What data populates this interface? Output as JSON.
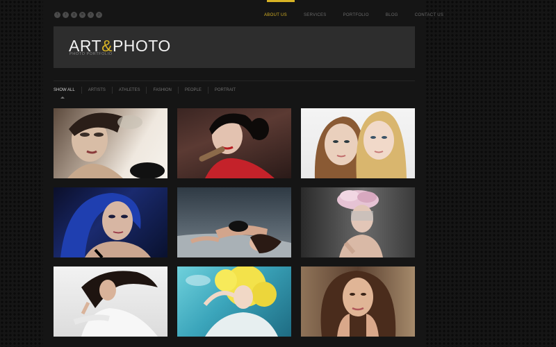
{
  "social": {
    "icons": [
      "facebook-icon",
      "twitter-icon",
      "google-plus-icon",
      "linkedin-icon",
      "rss-icon",
      "pinterest-icon"
    ],
    "glyphs": [
      "f",
      "t",
      "g",
      "in",
      "r",
      "p"
    ]
  },
  "nav": {
    "items": [
      "ABOUT US",
      "SERVICES",
      "PORTFOLIO",
      "BLOG",
      "CONTACT US"
    ],
    "active_color": "#d8b325"
  },
  "logo": {
    "part1": "ART",
    "amp": "&",
    "part2": "PHOTO",
    "subtitle": "PHOTO PORTFOLIO"
  },
  "filters": [
    "SHOW ALL",
    "ARTISTS",
    "ATHLETES",
    "FASHION",
    "PEOPLE",
    "PORTRAIT"
  ],
  "colors": {
    "accent": "#d8b325",
    "background": "#151515",
    "header_band": "#2d2d2d"
  },
  "gallery": {
    "photos": [
      "fashion-portrait-photo",
      "vintage-singer-photo",
      "two-women-portrait-photo",
      "blue-hair-portrait-photo",
      "reclining-woman-photo",
      "feather-headdress-photo",
      "wind-hair-photo",
      "yellow-hair-photo",
      "brunette-portrait-photo"
    ]
  }
}
